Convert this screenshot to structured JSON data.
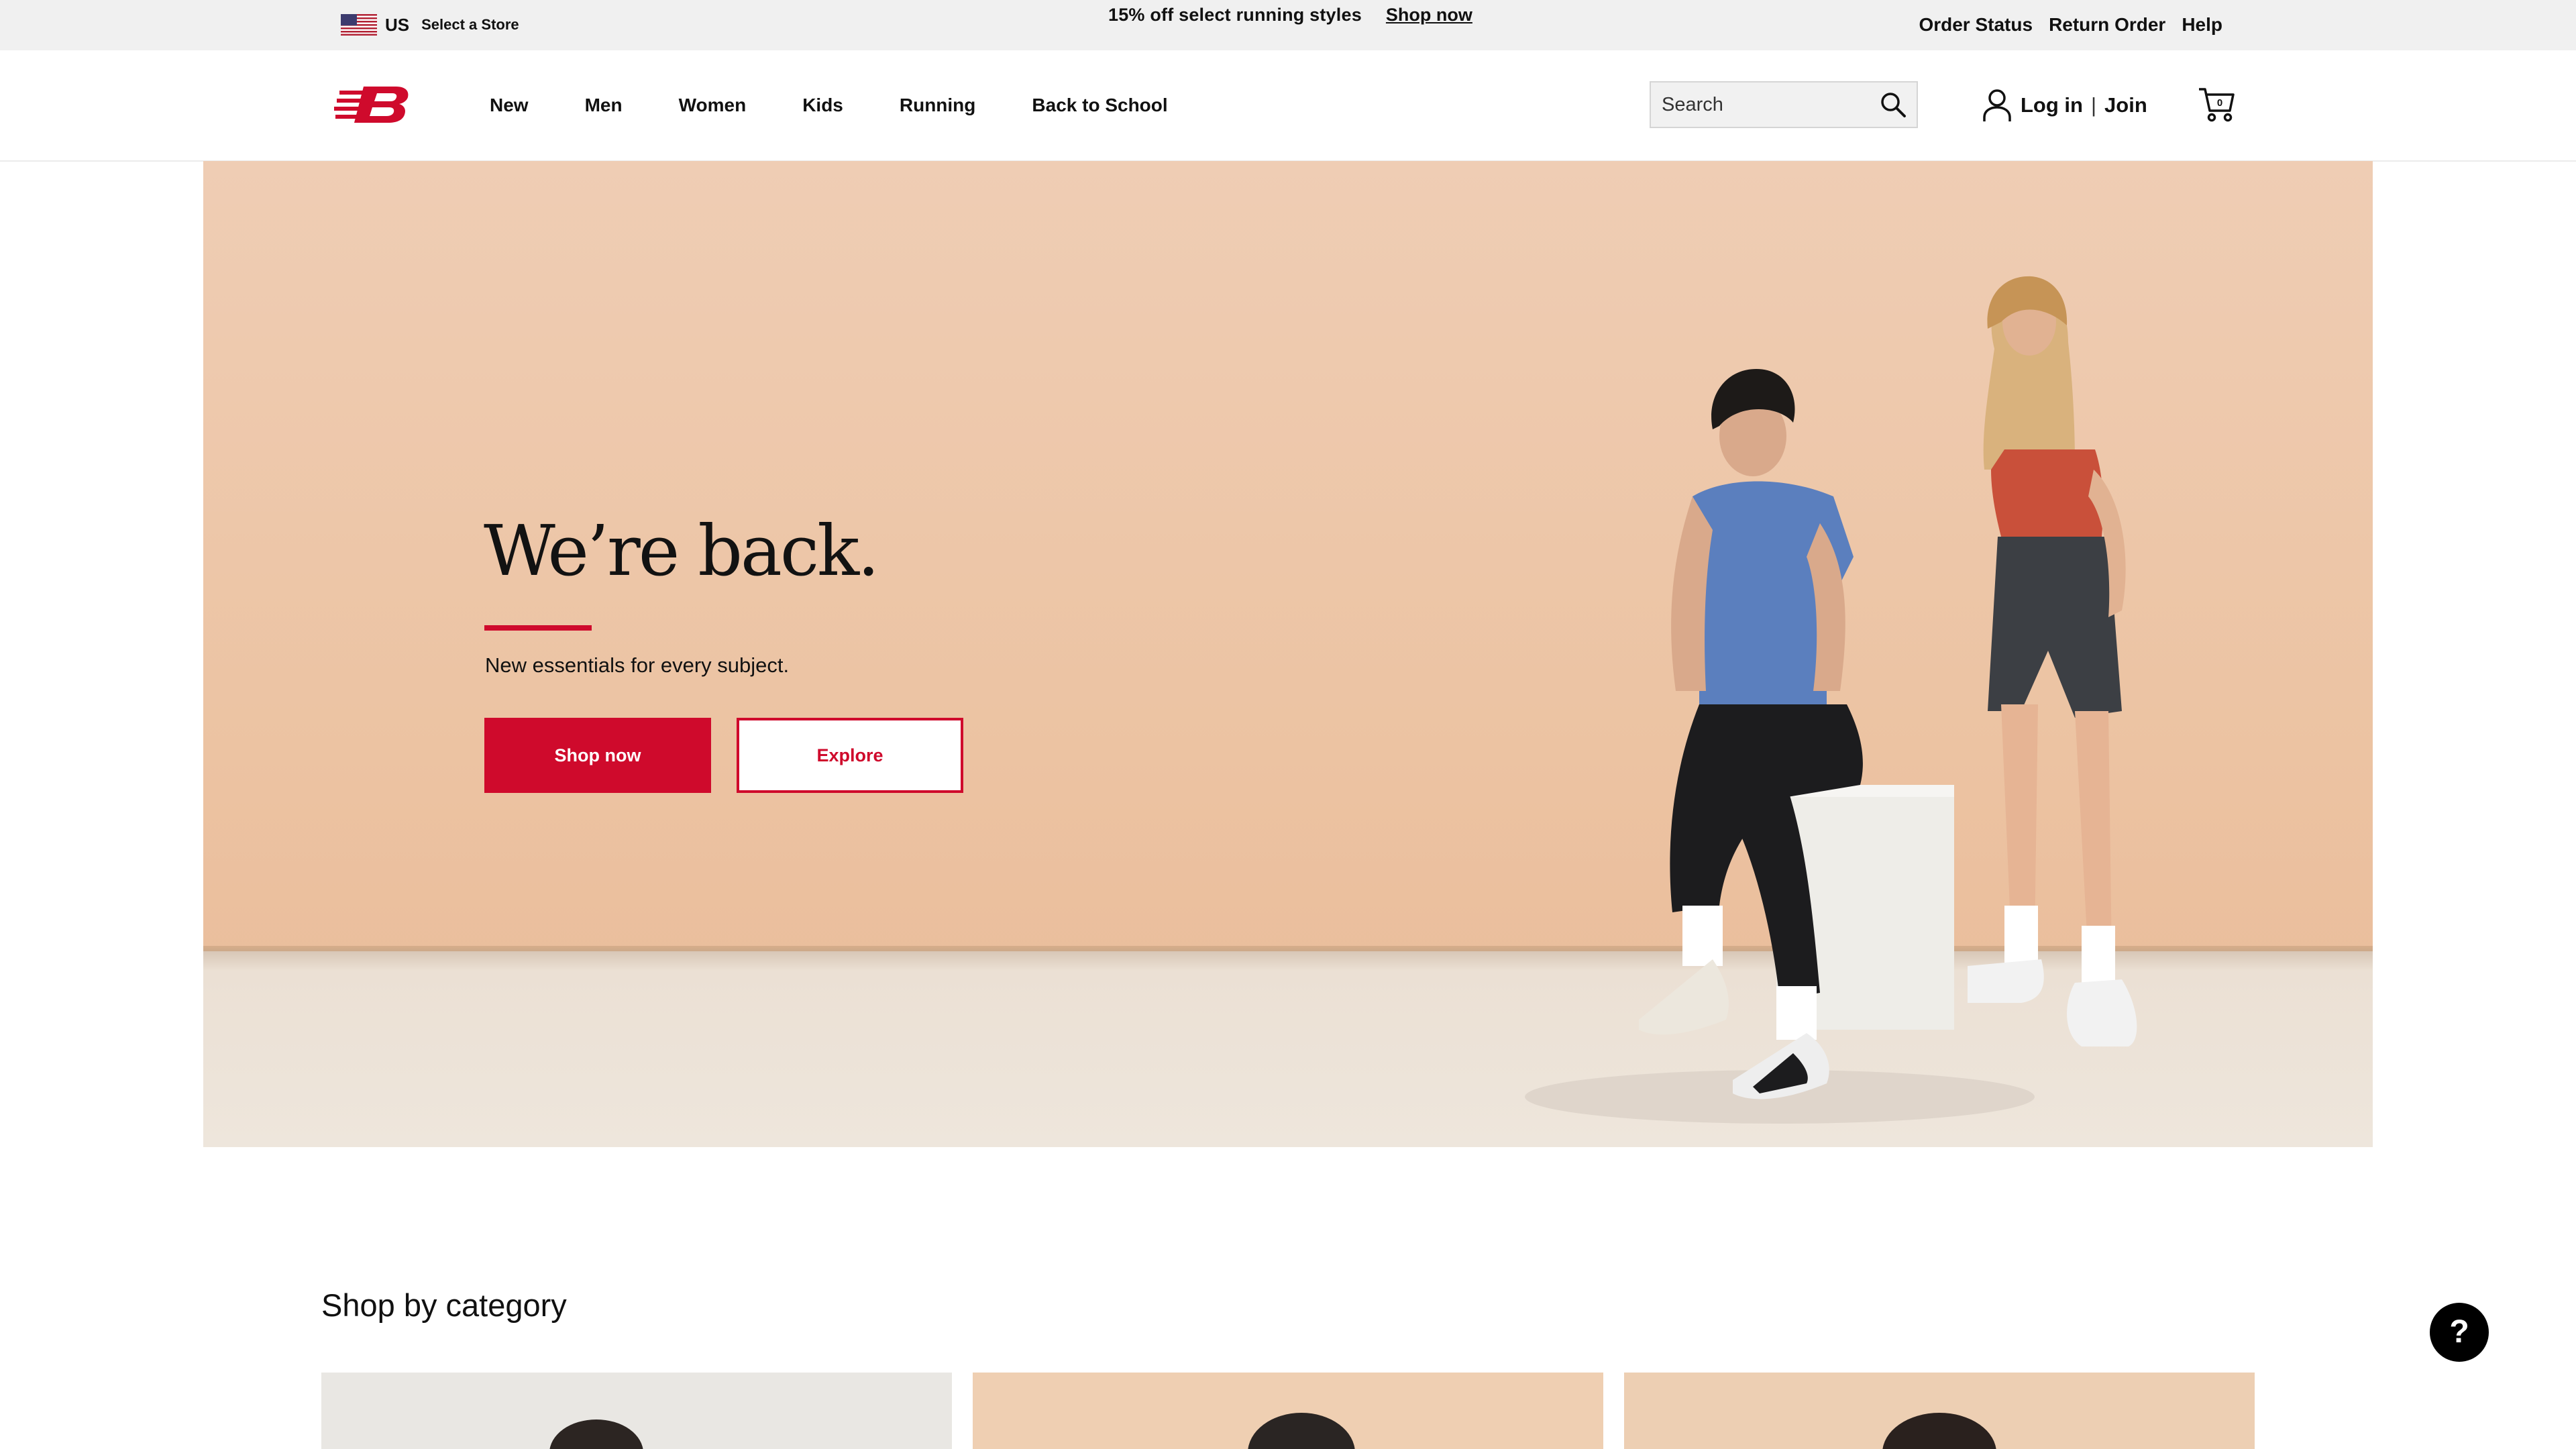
{
  "topbar": {
    "region_code": "US",
    "store_label": "Select a Store",
    "promo_text": "15% off select running styles",
    "promo_link": "Shop now",
    "order_status": "Order Status",
    "return_order": "Return Order",
    "help": "Help"
  },
  "nav": {
    "items": [
      "New",
      "Men",
      "Women",
      "Kids",
      "Running",
      "Back to School"
    ]
  },
  "search": {
    "placeholder": "Search"
  },
  "account": {
    "login": "Log in",
    "separator": "|",
    "join": "Join"
  },
  "hero": {
    "title": "We’re back.",
    "subtitle": "New essentials for every subject.",
    "primary_button": "Shop now",
    "secondary_button": "Explore"
  },
  "category": {
    "title": "Shop by category"
  },
  "help_button": {
    "label": "?"
  },
  "colors": {
    "brand_red": "#cf0a2c",
    "topbar_bg": "#f0f0f0",
    "hero_bg": "#ecc3a2",
    "text": "#111111"
  },
  "icons": [
    "us-flag-icon",
    "new-balance-logo",
    "search-icon",
    "user-icon",
    "cart-icon",
    "help-icon"
  ]
}
